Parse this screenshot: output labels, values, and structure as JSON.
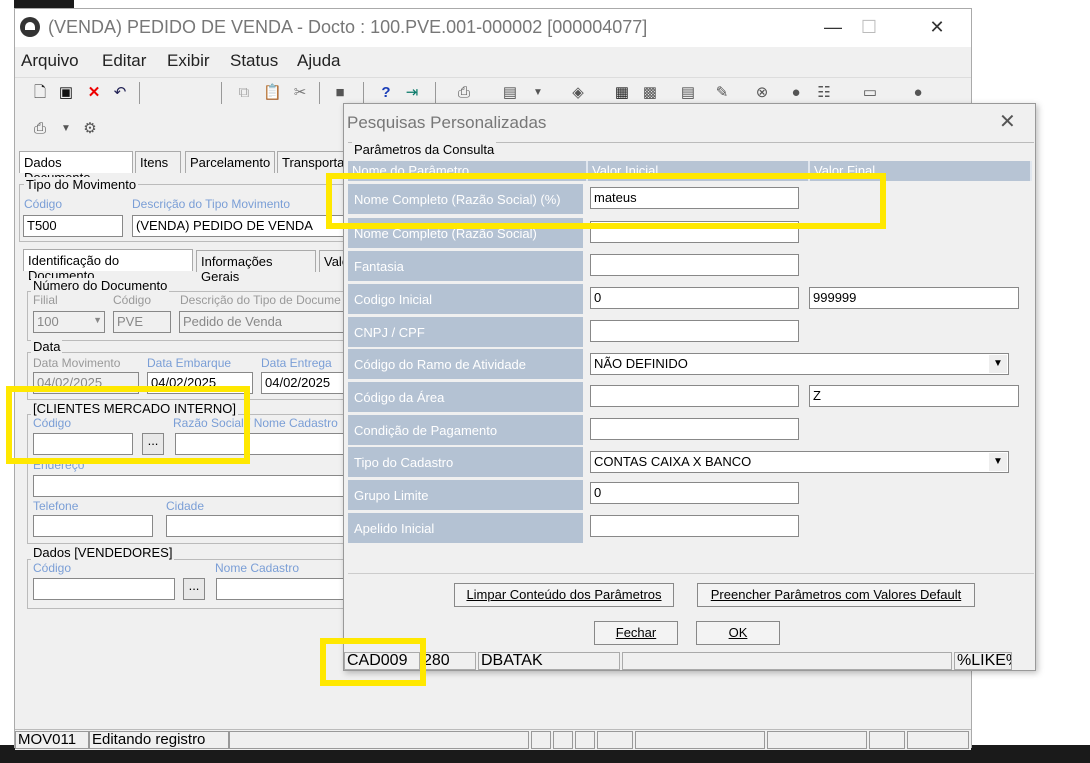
{
  "window": {
    "title": "(VENDA) PEDIDO DE VENDA - Docto : 100.PVE.001-000002 [000004077]",
    "minimize": "—",
    "maximize": "☐",
    "close": "✕"
  },
  "menu": [
    "Arquivo",
    "Editar",
    "Exibir",
    "Status",
    "Ajuda"
  ],
  "tabs": [
    "Dados Documento",
    "Itens",
    "Parcelamento",
    "Transporta"
  ],
  "tipo_movimento": {
    "group_label": "Tipo do Movimento",
    "codigo_label": "Código",
    "codigo_value": "T500",
    "descricao_label": "Descrição do Tipo Movimento",
    "descricao_value": "(VENDA) PEDIDO DE VENDA"
  },
  "subtabs": [
    "Identificação do Documento",
    "Informações Gerais",
    "Valo"
  ],
  "numero_documento": {
    "group_label": "Número do Documento",
    "filial_label": "Filial",
    "filial_value": "100",
    "codigo_label": "Código",
    "codigo_value": "PVE",
    "descricao_label": "Descrição do Tipo de Docume",
    "descricao_value": "Pedido de Venda"
  },
  "data": {
    "group_label": "Data",
    "movimento_label": "Data Movimento",
    "movimento_value": "04/02/2025",
    "embarque_label": "Data Embarque",
    "embarque_value": "04/02/2025",
    "entrega_label": "Data Entrega",
    "entrega_value": "04/02/2025"
  },
  "clientes": {
    "group_label": "[CLIENTES MERCADO INTERNO]",
    "codigo_label": "Código",
    "razao_label": "Razão Social / Nome Cadastro",
    "endereco_label": "Endereço",
    "telefone_label": "Telefone",
    "cidade_label": "Cidade",
    "lookup_label": "..."
  },
  "vendedores": {
    "group_label": "Dados [VENDEDORES]",
    "codigo_label": "Código",
    "nome_label": "Nome Cadastro",
    "lookup_label": "..."
  },
  "statusbar": {
    "code": "MOV011",
    "message": "Editando registro"
  },
  "dialog": {
    "title": "Pesquisas Personalizadas",
    "close": "✕",
    "group_label": "Parâmetros da Consulta",
    "headers": [
      "Nome do Parâmetro",
      "Valor Inicial",
      "Valor Final"
    ],
    "params": [
      {
        "name": "Nome Completo (Razão Social) (%)",
        "initial": "mateus",
        "final": null,
        "type": "text"
      },
      {
        "name": "Nome Completo (Razão Social)",
        "initial": "",
        "final": null,
        "type": "text"
      },
      {
        "name": "Fantasia",
        "initial": "",
        "final": null,
        "type": "text"
      },
      {
        "name": "Codigo Inicial",
        "initial": "0",
        "final": "999999",
        "type": "range"
      },
      {
        "name": "CNPJ / CPF",
        "initial": "",
        "final": null,
        "type": "text"
      },
      {
        "name": "Código do Ramo de Atividade",
        "initial": "NÃO DEFINIDO",
        "final": null,
        "type": "select"
      },
      {
        "name": "Código da Área",
        "initial": "",
        "final": "Z",
        "type": "range"
      },
      {
        "name": "Condição de Pagamento",
        "initial": "",
        "final": null,
        "type": "text"
      },
      {
        "name": "Tipo do Cadastro",
        "initial": "CONTAS CAIXA X BANCO",
        "final": null,
        "type": "select"
      },
      {
        "name": "Grupo Limite",
        "initial": "0",
        "final": null,
        "type": "text"
      },
      {
        "name": "Apelido Inicial",
        "initial": "",
        "final": null,
        "type": "text"
      }
    ],
    "btn_limpar": "Limpar Conteúdo dos Parâmetros",
    "btn_preencher": "Preencher Parâmetros com Valores Default",
    "btn_fechar": "Fechar",
    "btn_ok": "OK",
    "status": [
      "CAD009",
      "280",
      "DBATAK",
      "",
      "%LIKE%"
    ]
  },
  "colors": {
    "highlight": "#ffe800",
    "param_cell": "#b4c2d3",
    "field_label": "#7a9ed6"
  }
}
